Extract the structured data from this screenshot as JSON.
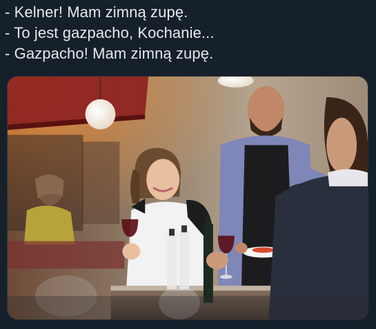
{
  "post": {
    "lines": [
      "- Kelner! Mam zimną zupę.",
      "- To jest gazpacho, Kochanie...",
      "- Gazpacho! Mam zimną zupę."
    ]
  },
  "media": {
    "kind": "photo",
    "colors": {
      "wall": "#a89683",
      "wall_dark": "#5b4a3c",
      "awning": "#8c1f1f",
      "apron": "#1c1c1e",
      "shirt": "#7f86b8",
      "suit": "#2a2f3d",
      "wine": "#5a0d14"
    }
  }
}
